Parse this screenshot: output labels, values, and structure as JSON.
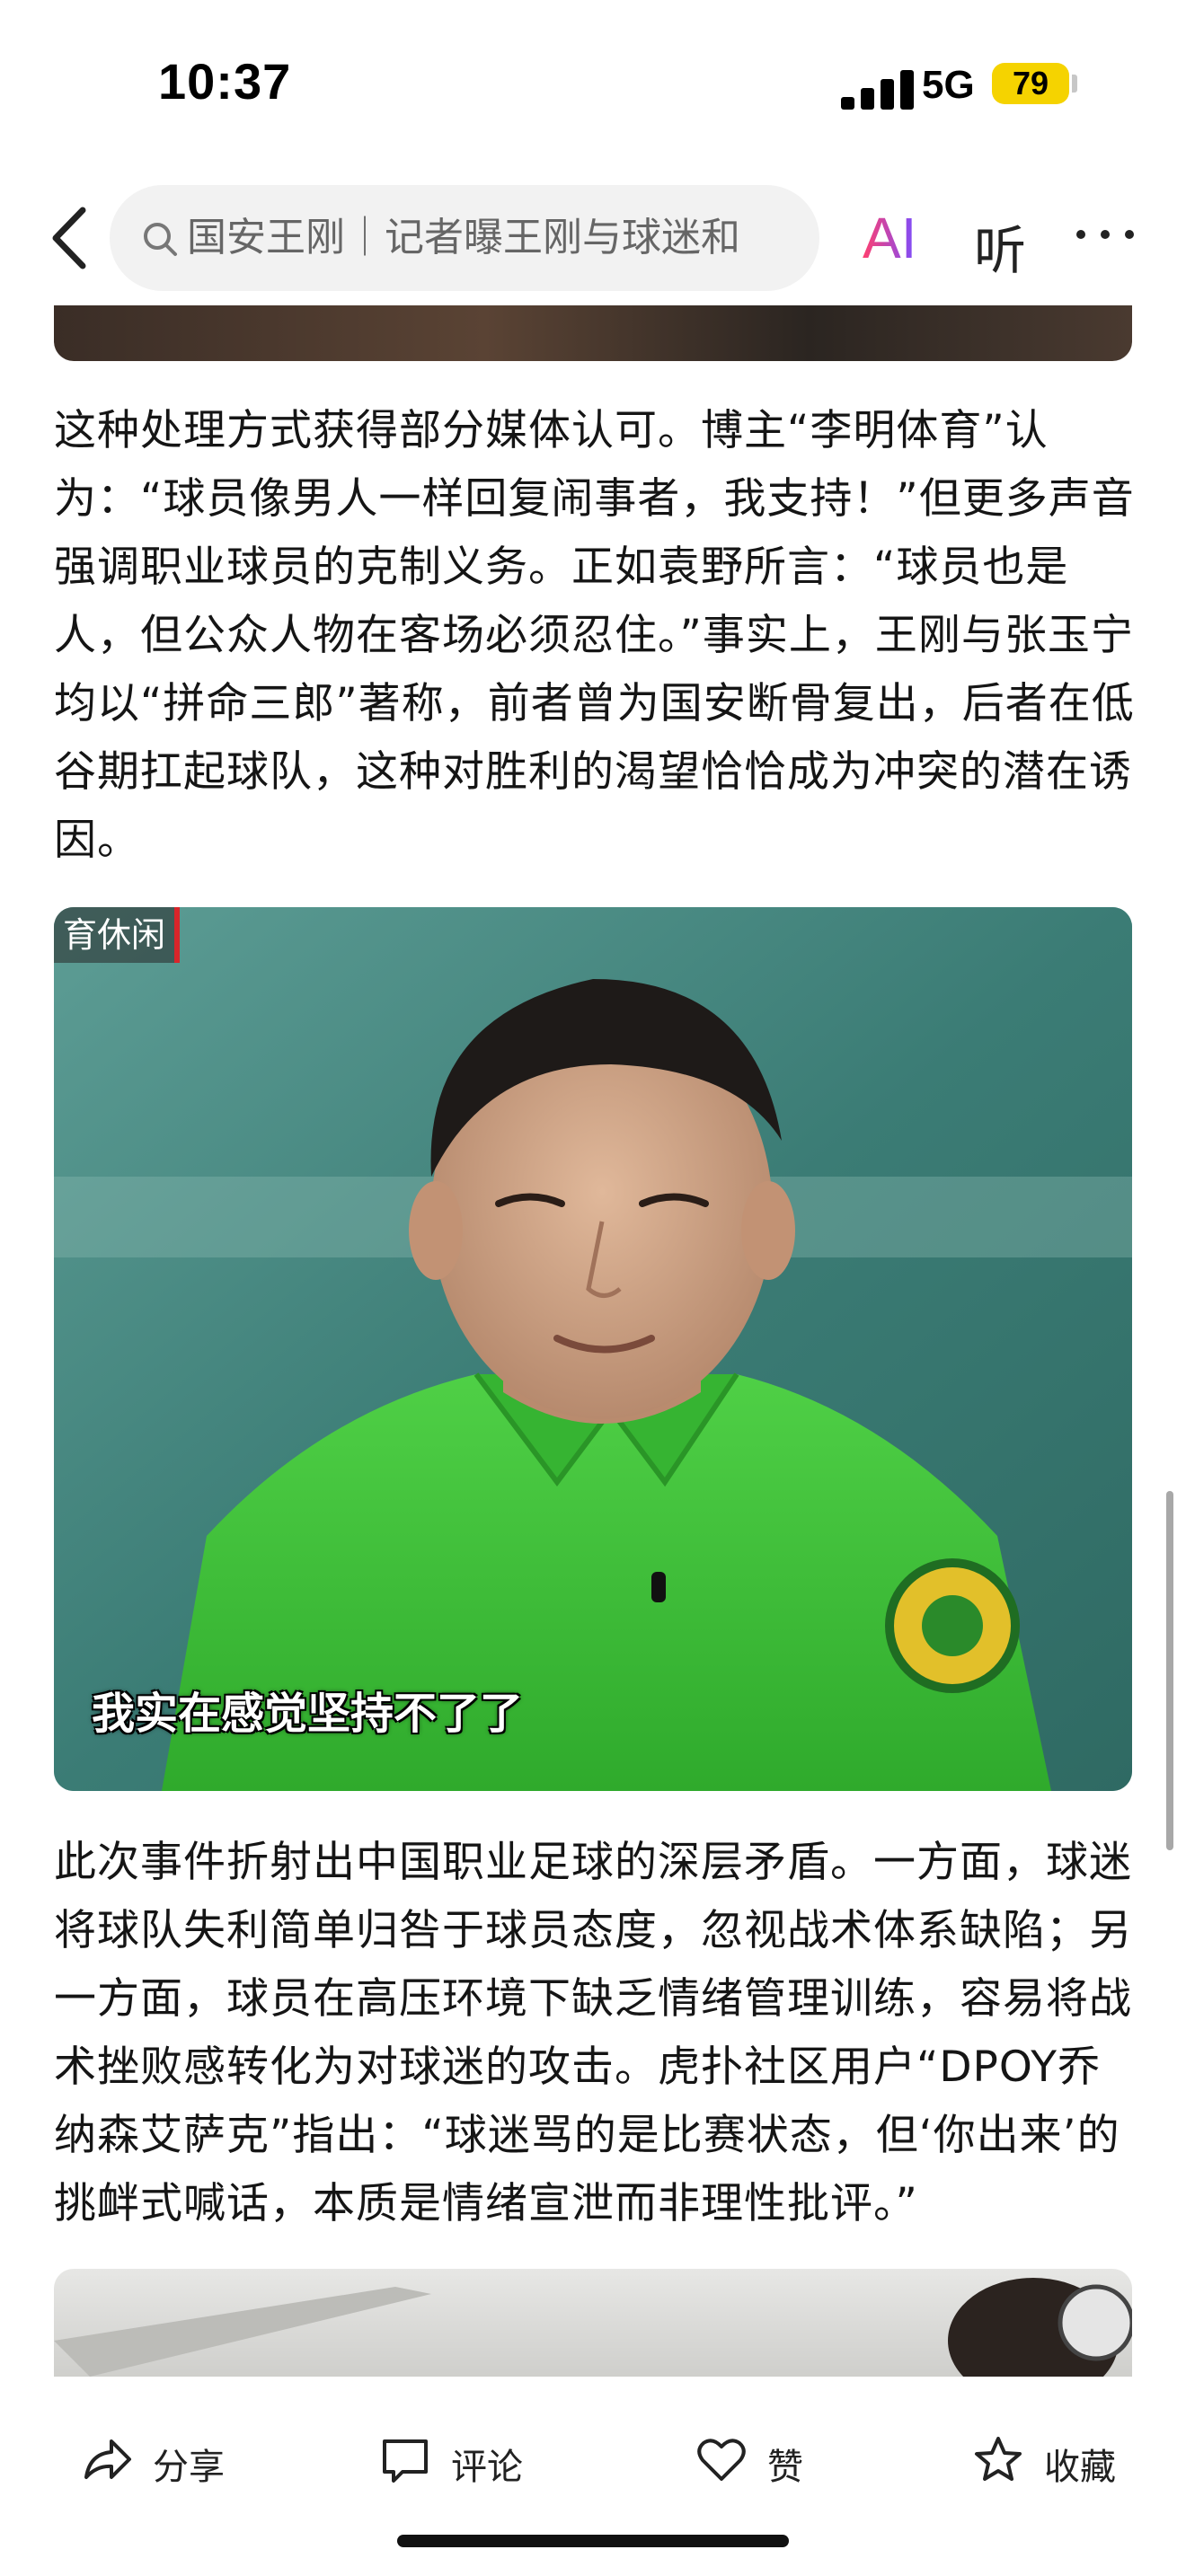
{
  "status_bar": {
    "time": "10:37",
    "network": "5G",
    "battery": "79"
  },
  "nav": {
    "search_text": "国安王刚｜记者曝王刚与球迷和",
    "ai_label": "AI",
    "listen_label": "听",
    "icons": [
      "chevron-left-icon",
      "search-icon",
      "more-icon"
    ]
  },
  "article": {
    "paragraph_1": "这种处理方式获得部分媒体认可。博主“李明体育”认为：“球员像男人一样回复闹事者，我支持！”但更多声音强调职业球员的克制义务。正如袁野所言：“球员也是人，但公众人物在客场必须忍住。”事实上，王刚与张玉宁均以“拼命三郎”著称，前者曾为国安断骨复出，后者在低谷期扛起球队，这种对胜利的渴望恰恰成为冲突的潜在诱因。",
    "image_tag": "育休闲",
    "image_caption": "我实在感觉坚持不了了",
    "paragraph_2": "此次事件折射出中国职业足球的深层矛盾。一方面，球迷将球队失利简单归咎于球员态度，忽视战术体系缺陷；另一方面，球员在高压环境下缺乏情绪管理训练，容易将战术挫败感转化为对球迷的攻击。虎扑社区用户“DPOY乔纳森艾萨克”指出：“球迷骂的是比赛状态，但‘你出来’的挑衅式喊话，本质是情绪宣泄而非理性批评。”"
  },
  "actions": {
    "share": "分享",
    "comment": "评论",
    "like": "赞",
    "favorite": "收藏",
    "icons": [
      "share-icon",
      "comment-icon",
      "heart-icon",
      "star-icon"
    ]
  },
  "colors": {
    "battery": "#f5d300",
    "jersey_green": "#3fbf3a",
    "ai_gradient_start": "#ff3f6f",
    "ai_gradient_end": "#7a4dff"
  }
}
